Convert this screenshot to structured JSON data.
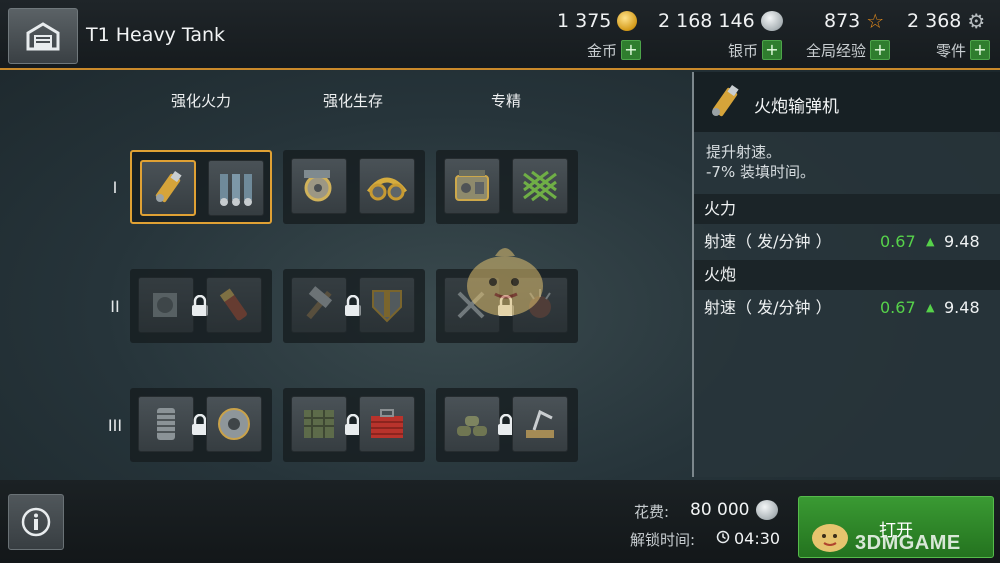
{
  "header": {
    "tank_name": "T1 Heavy Tank",
    "resources": [
      {
        "value": "1 375",
        "label": "金币",
        "icon": "gold-coin-icon"
      },
      {
        "value": "2 168 146",
        "label": "银币",
        "icon": "silver-coin-icon"
      },
      {
        "value": "873",
        "label": "全局经验",
        "icon": "star-icon"
      },
      {
        "value": "2 368",
        "label": "零件",
        "icon": "gear-icon"
      }
    ],
    "plus": "+"
  },
  "columns": [
    "强化火力",
    "强化生存",
    "专精"
  ],
  "tiers": [
    "I",
    "II",
    "III"
  ],
  "modules": {
    "firepower": [
      [
        "shell-rammer-icon",
        "rockets-icon"
      ],
      [
        "cannon-breech-icon",
        "armor-shell-icon"
      ],
      [
        "spring-coil-icon",
        "turbine-icon"
      ]
    ],
    "survival": [
      [
        "engine-icon",
        "goggles-icon"
      ],
      [
        "hammer-icon",
        "armor-plate-icon"
      ],
      [
        "camo-net-icon",
        "toolbox-icon"
      ]
    ],
    "specialization": [
      [
        "radio-icon",
        "net-icon"
      ],
      [
        "crossed-tools-icon",
        "explosive-icon"
      ],
      [
        "sandbags-icon",
        "crane-icon"
      ]
    ]
  },
  "panel": {
    "title": "火炮输弹机",
    "desc_1": "提升射速。",
    "desc_2": "-7% 装填时间。",
    "sections": [
      {
        "head": "火力",
        "label": "射速（ 发/分钟 ）",
        "old": "0.67",
        "new": "9.48"
      },
      {
        "head": "火炮",
        "label": "射速（ 发/分钟 ）",
        "old": "0.67",
        "new": "9.48"
      }
    ]
  },
  "footer": {
    "cost_label": "花费:",
    "cost_value": "80 000",
    "unlock_label": "解锁时间:",
    "unlock_value": "04:30",
    "open_button": "打开",
    "watermark": "3DMGAME"
  },
  "colors": {
    "accent": "#e0a134",
    "green": "#56d24a",
    "button_green": "#2f7d2e"
  }
}
